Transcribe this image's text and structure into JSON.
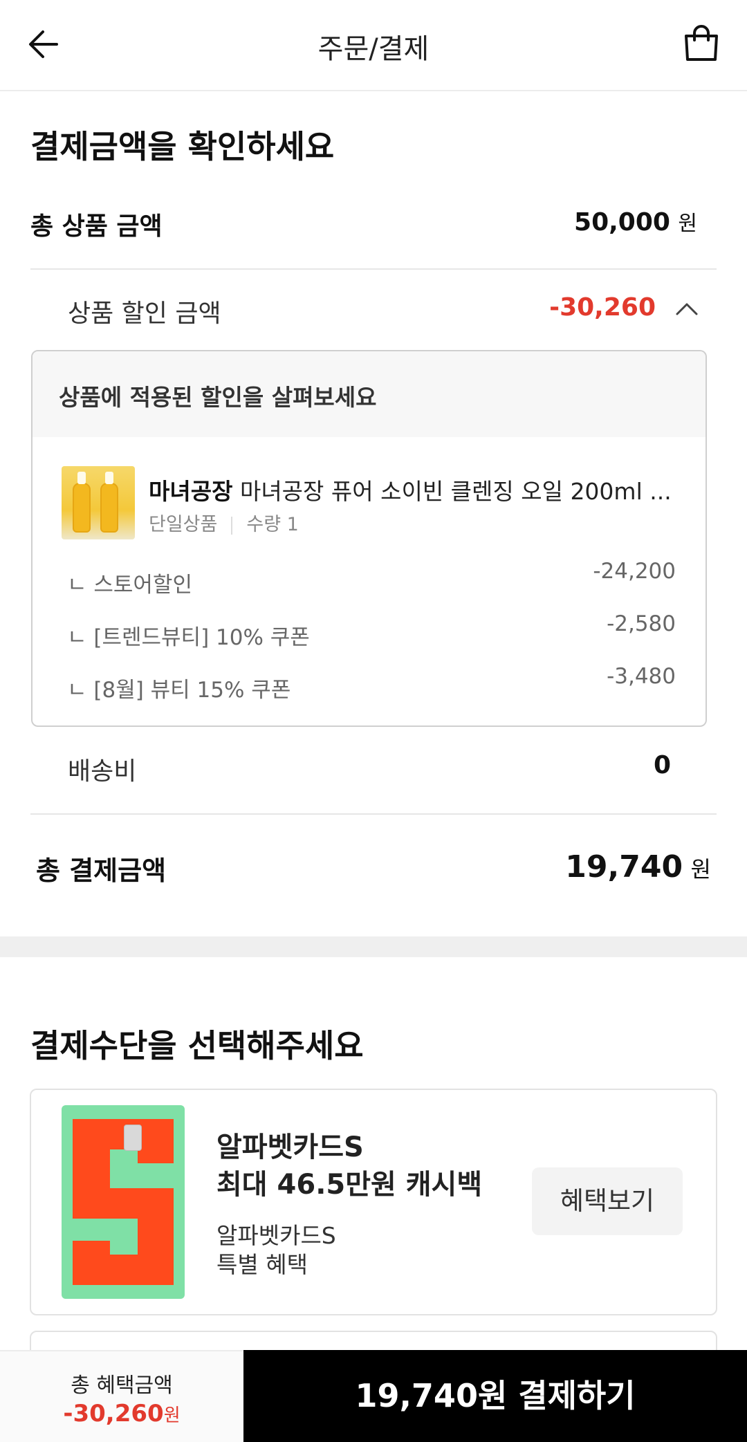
{
  "header": {
    "title": "주문/결제",
    "back_icon": "arrow-left-icon",
    "cart_icon": "shopping-bag-icon"
  },
  "summary": {
    "title": "결제금액을 확인하세요",
    "total_product": {
      "label": "총 상품 금액",
      "value": "50,000",
      "unit": "원"
    },
    "discount": {
      "label": "상품 할인 금액",
      "value": "-30,260",
      "toggle_icon": "chevron-up-icon"
    },
    "detail": {
      "heading": "상품에 적용된 할인을 살펴보세요",
      "product": {
        "brand": "마녀공장",
        "name": "마녀공장 퓨어 소이빈 클렌징 오일 200ml ...",
        "type": "단일상품",
        "quantity": "수량 1"
      },
      "items": [
        {
          "label": "ㄴ 스토어할인",
          "amount": "-24,200"
        },
        {
          "label": "ㄴ [트렌드뷰티] 10% 쿠폰",
          "amount": "-2,580"
        },
        {
          "label": "ㄴ [8월] 뷰티 15% 쿠폰",
          "amount": "-3,480"
        }
      ]
    },
    "shipping": {
      "label": "배송비",
      "value": "0"
    },
    "total_payment": {
      "label": "총 결제금액",
      "value": "19,740",
      "unit": "원"
    }
  },
  "payment": {
    "title": "결제수단을 선택해주세요",
    "card": {
      "name": "알파벳카드S",
      "promo": "최대 46.5만원 캐시백",
      "desc_line1": "알파벳카드S",
      "desc_line2": "특별 혜택",
      "button": "혜택보기"
    }
  },
  "bottom": {
    "benefit_label": "총 혜택금액",
    "benefit_value": "-30,260",
    "benefit_unit": "원",
    "pay_button": "19,740원 결제하기"
  },
  "colors": {
    "accent_red": "#e23a2d",
    "card_green": "#7fe0a6",
    "card_orange": "#ff4a1c",
    "pay_button_bg": "#000000"
  }
}
